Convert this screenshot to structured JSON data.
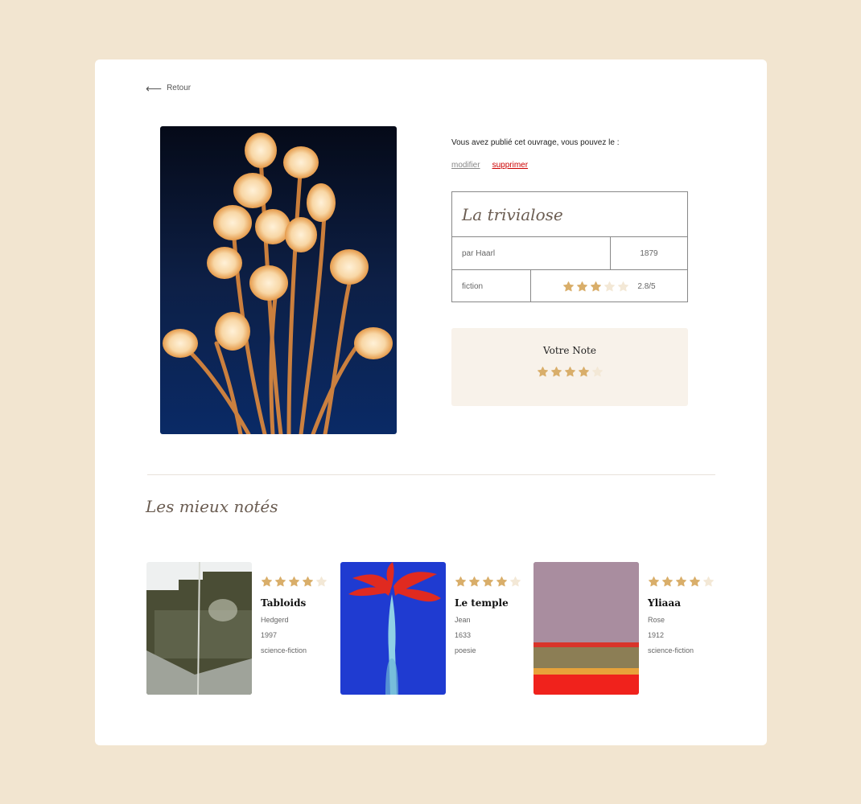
{
  "colors": {
    "page_bg": "#f2e5d0",
    "star_filled": "#d9ae6a",
    "star_empty": "#f3e8d6",
    "title_color": "#6b5d52",
    "delete_color": "#cc0000"
  },
  "nav": {
    "back_label": "Retour",
    "back_icon": "arrow-left-icon"
  },
  "book": {
    "owner_message": "Vous avez publié cet ouvrage, vous pouvez le :",
    "edit_label": "modifier",
    "delete_label": "supprimer",
    "title": "La trivialose",
    "author": "par Haarl",
    "year": "1879",
    "genre": "fiction",
    "average_rating": 2.8,
    "rating_text": "2.8/5",
    "stars_shown": 3
  },
  "vote": {
    "label": "Votre Note",
    "user_rating": 4,
    "max": 5
  },
  "top_rated": {
    "title": "Les mieux notés",
    "items": [
      {
        "title": "Tabloids",
        "author": "Hedgerd",
        "year": "1997",
        "genre": "science-fiction",
        "rating": 4
      },
      {
        "title": "Le temple",
        "author": "Jean",
        "year": "1633",
        "genre": "poesie",
        "rating": 4
      },
      {
        "title": "Yliaaa",
        "author": "Rose",
        "year": "1912",
        "genre": "science-fiction",
        "rating": 4
      }
    ]
  }
}
